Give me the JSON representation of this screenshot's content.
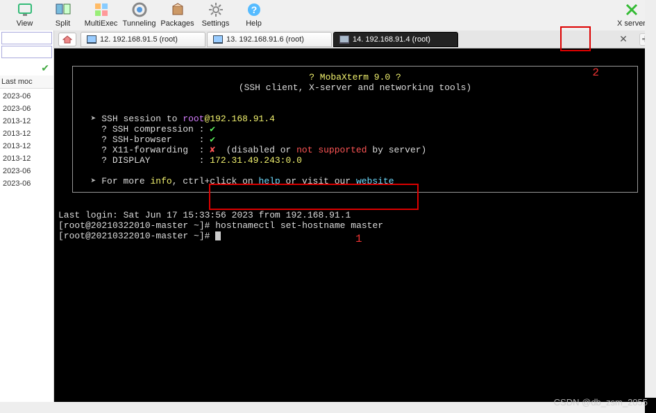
{
  "toolbar": {
    "view": "View",
    "split": "Split",
    "multiexec": "MultiExec",
    "tunneling": "Tunneling",
    "packages": "Packages",
    "settings": "Settings",
    "help": "Help",
    "xserver": "X server"
  },
  "sidebar": {
    "lastmod": "Last moc",
    "dates": [
      "2023-06",
      "2023-06",
      "2013-12",
      "2013-12",
      "2013-12",
      "2013-12",
      "2023-06",
      "2023-06"
    ]
  },
  "tabs": {
    "t1": "12. 192.168.91.5 (root)",
    "t2": "13. 192.168.91.6 (root)",
    "t3": "14. 192.168.91.4 (root)"
  },
  "terminal": {
    "title": "? MobaXterm 9.0 ?",
    "subtitle": "(SSH client, X-server and networking tools)",
    "sess_prefix": "SSH session to ",
    "sess_user": "root",
    "sess_at": "@",
    "sess_host": "192.168.91.4",
    "l1": "? SSH compression : ",
    "l2": "? SSH-browser     : ",
    "l3a": "? X11-forwarding  : ",
    "l3b": "  (disabled or ",
    "l3c": "not supported",
    "l3d": " by server)",
    "l4a": "? DISPLAY         : ",
    "l4b": "172.31.49.243:0.0",
    "ftr1": "For more ",
    "ftr_info": "info",
    "ftr2": ", ctrl+click on ",
    "ftr_help": "help",
    "ftr3": " or visit our ",
    "ftr_web": "website",
    "login": "Last login: Sat Jun 17 15:33:56 2023 from 192.168.91.1",
    "prompt1": "[root@20210322010-master ~]# ",
    "cmd1": "hostnamectl set-hostname master",
    "prompt2": "[root@20210322010-master ~]# "
  },
  "annotations": {
    "a1": "1",
    "a2": "2"
  },
  "watermark": "CSDN @db_zsm_2055"
}
